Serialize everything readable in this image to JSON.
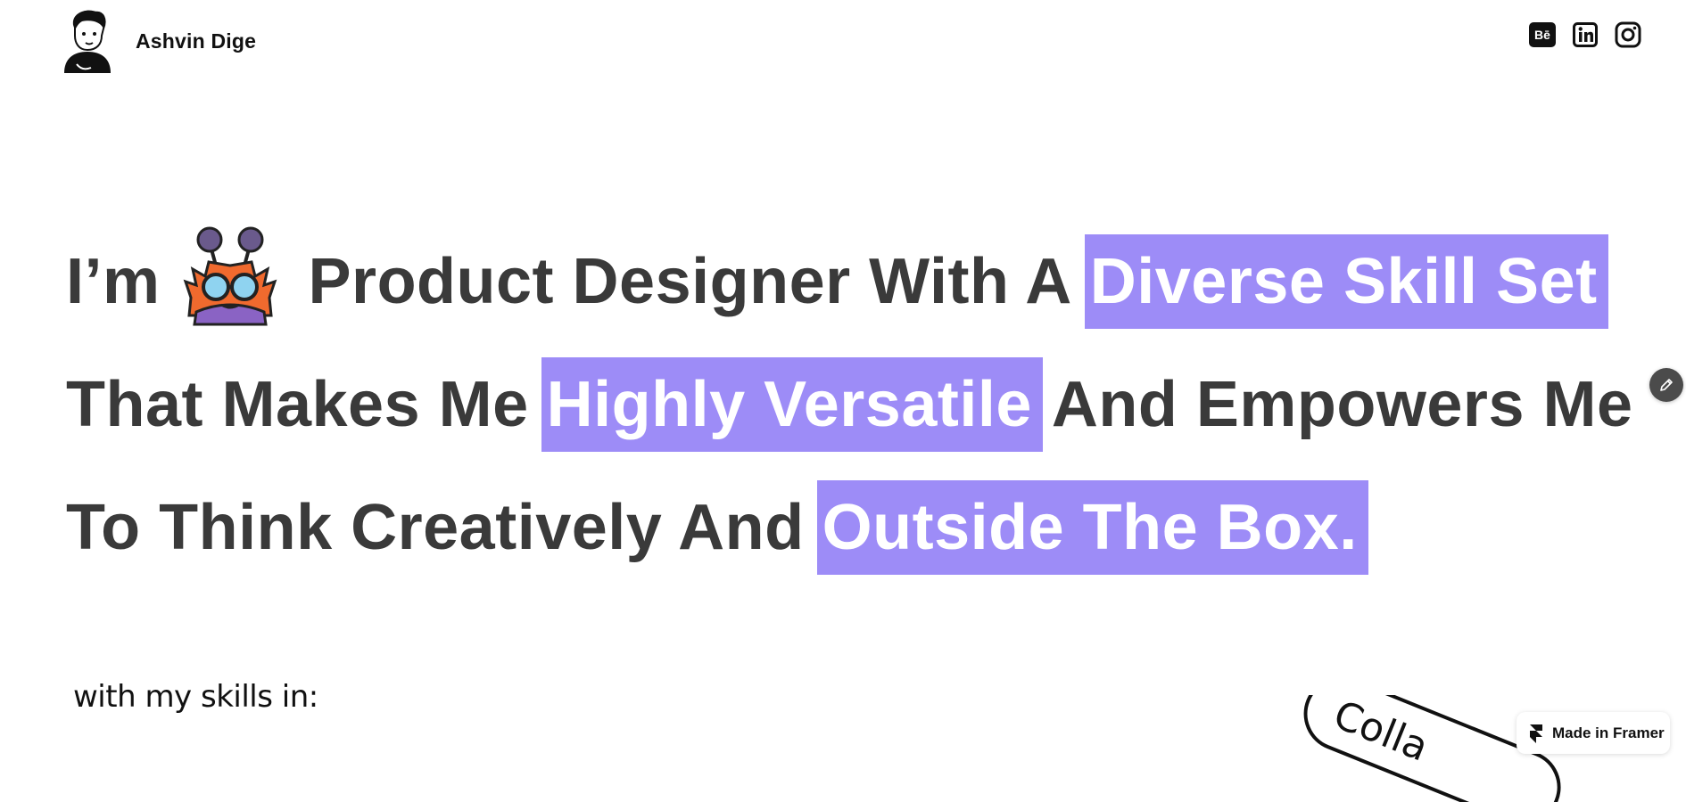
{
  "header": {
    "brand_name": "Ashvin Dige",
    "social_icons": [
      "behance-icon",
      "linkedin-icon",
      "instagram-icon"
    ]
  },
  "hero": {
    "line1_start": "I’m",
    "line1_mid": "Product Designer With A",
    "line1_highlight": "Diverse Skill Set",
    "line2_start": "That Makes Me",
    "line2_highlight": "Highly Versatile",
    "line2_end": "And Empowers Me",
    "line3_start": "To Think Creatively And",
    "line3_highlight": "Outside The Box."
  },
  "skills_intro": "with my skills in:",
  "collab_badge_text": "Colla",
  "framer_badge": {
    "label": "Made in Framer",
    "icon": "framer-logo-icon"
  },
  "edit_button": {
    "icon": "pencil-icon"
  },
  "colors": {
    "highlight": "#9d8cf7",
    "heading_text": "#3a3a3a",
    "highlight_text": "#ffffff"
  }
}
